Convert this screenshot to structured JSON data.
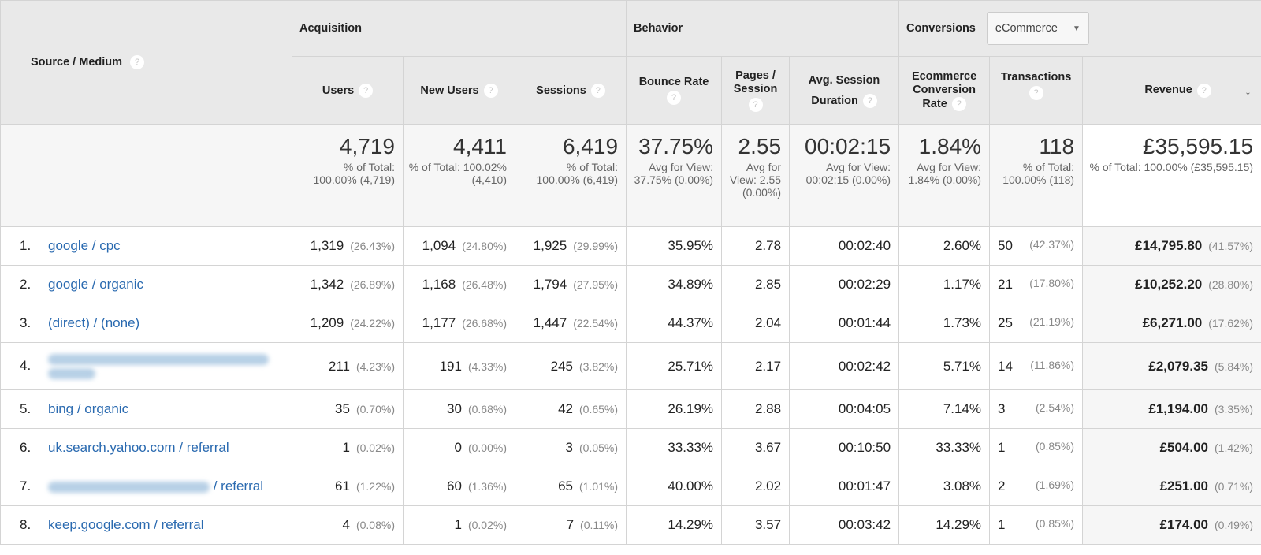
{
  "header": {
    "source_medium": "Source / Medium",
    "groups": {
      "acquisition": "Acquisition",
      "behavior": "Behavior",
      "conversions": "Conversions"
    },
    "conversions_dropdown": {
      "selected": "eCommerce"
    },
    "columns": {
      "users": "Users",
      "new_users": "New Users",
      "sessions": "Sessions",
      "bounce_rate": "Bounce Rate",
      "pages_session": "Pages / Session",
      "avg_session_duration": "Avg. Session Duration",
      "ecom_conv_rate": "Ecommerce Conversion Rate",
      "transactions": "Transactions",
      "revenue": "Revenue"
    },
    "help_glyph": "?",
    "sort_glyph": "↓"
  },
  "totals": {
    "users": {
      "value": "4,719",
      "sub": "% of Total: 100.00% (4,719)"
    },
    "new_users": {
      "value": "4,411",
      "sub": "% of Total: 100.02% (4,410)"
    },
    "sessions": {
      "value": "6,419",
      "sub": "% of Total: 100.00% (6,419)"
    },
    "bounce_rate": {
      "value": "37.75%",
      "sub": "Avg for View: 37.75% (0.00%)"
    },
    "pages_session": {
      "value": "2.55",
      "sub": "Avg for View: 2.55 (0.00%)"
    },
    "avg_session_duration": {
      "value": "00:02:15",
      "sub": "Avg for View: 00:02:15 (0.00%)"
    },
    "ecom_conv_rate": {
      "value": "1.84%",
      "sub": "Avg for View: 1.84% (0.00%)"
    },
    "transactions": {
      "value": "118",
      "sub": "% of Total: 100.00% (118)"
    },
    "revenue": {
      "value": "£35,595.15",
      "sub": "% of Total: 100.00% (£35,595.15)"
    }
  },
  "rows": [
    {
      "idx": "1.",
      "source": "google / cpc",
      "users": "1,319",
      "users_pct": "(26.43%)",
      "new_users": "1,094",
      "new_users_pct": "(24.80%)",
      "sessions": "1,925",
      "sessions_pct": "(29.99%)",
      "bounce_rate": "35.95%",
      "pages_session": "2.78",
      "duration": "00:02:40",
      "conv_rate": "2.60%",
      "transactions": "50",
      "transactions_pct": "(42.37%)",
      "revenue": "£14,795.80",
      "revenue_pct": "(41.57%)"
    },
    {
      "idx": "2.",
      "source": "google / organic",
      "users": "1,342",
      "users_pct": "(26.89%)",
      "new_users": "1,168",
      "new_users_pct": "(26.48%)",
      "sessions": "1,794",
      "sessions_pct": "(27.95%)",
      "bounce_rate": "34.89%",
      "pages_session": "2.85",
      "duration": "00:02:29",
      "conv_rate": "1.17%",
      "transactions": "21",
      "transactions_pct": "(17.80%)",
      "revenue": "£10,252.20",
      "revenue_pct": "(28.80%)"
    },
    {
      "idx": "3.",
      "source": "(direct) / (none)",
      "users": "1,209",
      "users_pct": "(24.22%)",
      "new_users": "1,177",
      "new_users_pct": "(26.68%)",
      "sessions": "1,447",
      "sessions_pct": "(22.54%)",
      "bounce_rate": "44.37%",
      "pages_session": "2.04",
      "duration": "00:01:44",
      "conv_rate": "1.73%",
      "transactions": "25",
      "transactions_pct": "(21.19%)",
      "revenue": "£6,271.00",
      "revenue_pct": "(17.62%)"
    },
    {
      "idx": "4.",
      "source": "",
      "source_suffix": "",
      "redacted": true,
      "users": "211",
      "users_pct": "(4.23%)",
      "new_users": "191",
      "new_users_pct": "(4.33%)",
      "sessions": "245",
      "sessions_pct": "(3.82%)",
      "bounce_rate": "25.71%",
      "pages_session": "2.17",
      "duration": "00:02:42",
      "conv_rate": "5.71%",
      "transactions": "14",
      "transactions_pct": "(11.86%)",
      "revenue": "£2,079.35",
      "revenue_pct": "(5.84%)"
    },
    {
      "idx": "5.",
      "source": "bing / organic",
      "users": "35",
      "users_pct": "(0.70%)",
      "new_users": "30",
      "new_users_pct": "(0.68%)",
      "sessions": "42",
      "sessions_pct": "(0.65%)",
      "bounce_rate": "26.19%",
      "pages_session": "2.88",
      "duration": "00:04:05",
      "conv_rate": "7.14%",
      "transactions": "3",
      "transactions_pct": "(2.54%)",
      "revenue": "£1,194.00",
      "revenue_pct": "(3.35%)"
    },
    {
      "idx": "6.",
      "source": "uk.search.yahoo.com / referral",
      "users": "1",
      "users_pct": "(0.02%)",
      "new_users": "0",
      "new_users_pct": "(0.00%)",
      "sessions": "3",
      "sessions_pct": "(0.05%)",
      "bounce_rate": "33.33%",
      "pages_session": "3.67",
      "duration": "00:10:50",
      "conv_rate": "33.33%",
      "transactions": "1",
      "transactions_pct": "(0.85%)",
      "revenue": "£504.00",
      "revenue_pct": "(1.42%)"
    },
    {
      "idx": "7.",
      "source": "",
      "source_suffix": "/ referral",
      "redacted": true,
      "users": "61",
      "users_pct": "(1.22%)",
      "new_users": "60",
      "new_users_pct": "(1.36%)",
      "sessions": "65",
      "sessions_pct": "(1.01%)",
      "bounce_rate": "40.00%",
      "pages_session": "2.02",
      "duration": "00:01:47",
      "conv_rate": "3.08%",
      "transactions": "2",
      "transactions_pct": "(1.69%)",
      "revenue": "£251.00",
      "revenue_pct": "(0.71%)"
    },
    {
      "idx": "8.",
      "source": "keep.google.com / referral",
      "users": "4",
      "users_pct": "(0.08%)",
      "new_users": "1",
      "new_users_pct": "(0.02%)",
      "sessions": "7",
      "sessions_pct": "(0.11%)",
      "bounce_rate": "14.29%",
      "pages_session": "3.57",
      "duration": "00:03:42",
      "conv_rate": "14.29%",
      "transactions": "1",
      "transactions_pct": "(0.85%)",
      "revenue": "£174.00",
      "revenue_pct": "(0.49%)"
    }
  ]
}
